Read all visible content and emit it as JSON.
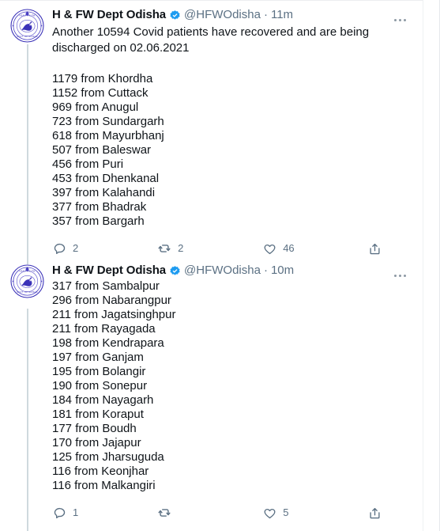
{
  "colors": {
    "background": "#ffffff",
    "text": "#0f1419",
    "muted": "#5b7083",
    "accent": "#1d9bf0",
    "thread_line": "#cfd9de",
    "avatar_emblem": "#3b32b8"
  },
  "thread": {
    "tweets": [
      {
        "avatar_icon": "odisha-health-dept-emblem",
        "display_name": "H & FW Dept Odisha",
        "verified_icon": "verified-badge-icon",
        "handle": "@HFWOdisha",
        "separator": "·",
        "timestamp": "11m",
        "more_icon": "more-options-icon",
        "text": "Another 10594 Covid patients have recovered and are being discharged on 02.06.2021",
        "districts": [
          "1179 from Khordha",
          "1152 from Cuttack",
          "969 from Anugul",
          "723 from Sundargarh",
          "618 from Mayurbhanj",
          "507 from Baleswar",
          "456 from Puri",
          "453 from Dhenkanal",
          "397 from Kalahandi",
          "377 from Bhadrak",
          "357 from Bargarh"
        ],
        "actions": {
          "reply": {
            "icon": "reply-icon",
            "count": "2"
          },
          "retweet": {
            "icon": "retweet-icon",
            "count": "2"
          },
          "like": {
            "icon": "like-heart-icon",
            "count": "46"
          },
          "share": {
            "icon": "share-icon",
            "count": ""
          }
        }
      },
      {
        "avatar_icon": "odisha-health-dept-emblem",
        "display_name": "H & FW Dept Odisha",
        "verified_icon": "verified-badge-icon",
        "handle": "@HFWOdisha",
        "separator": "·",
        "timestamp": "10m",
        "more_icon": "more-options-icon",
        "text": "",
        "districts": [
          "317 from Sambalpur",
          "296 from Nabarangpur",
          "211 from Jagatsinghpur",
          "211 from Rayagada",
          "198 from Kendrapara",
          "197 from Ganjam",
          "195 from Bolangir",
          "190 from Sonepur",
          "184 from Nayagarh",
          "181 from Koraput",
          "177 from Boudh",
          "170 from Jajapur",
          "125 from Jharsuguda",
          "116 from Keonjhar",
          "116 from Malkangiri"
        ],
        "actions": {
          "reply": {
            "icon": "reply-icon",
            "count": "1"
          },
          "retweet": {
            "icon": "retweet-icon",
            "count": ""
          },
          "like": {
            "icon": "like-heart-icon",
            "count": "5"
          },
          "share": {
            "icon": "share-icon",
            "count": ""
          }
        }
      }
    ]
  }
}
